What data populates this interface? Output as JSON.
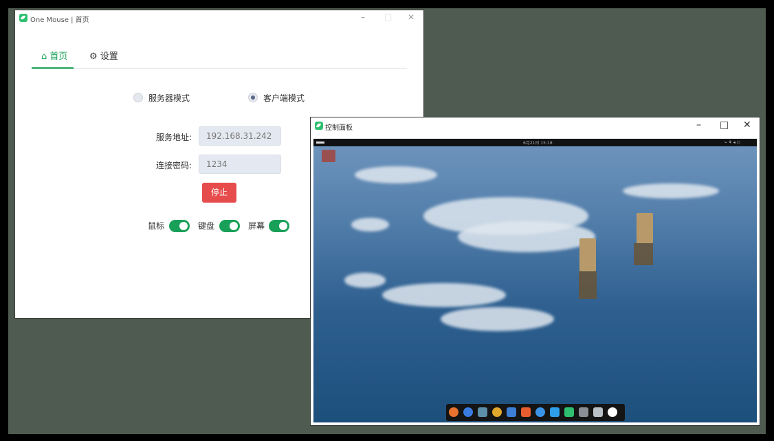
{
  "window1": {
    "title": "One Mouse | 首页",
    "controls": {
      "minimize": "–",
      "maximize": "□",
      "close": "✕"
    },
    "tabs": [
      {
        "icon": "home-icon",
        "glyph": "⌂",
        "label": "首页",
        "active": true
      },
      {
        "icon": "gear-icon",
        "glyph": "⚙",
        "label": "设置",
        "active": false
      }
    ],
    "mode": {
      "options": [
        {
          "label": "服务器模式",
          "checked": false
        },
        {
          "label": "客户端模式",
          "checked": true
        }
      ]
    },
    "server_address": {
      "label": "服务地址:",
      "value": "192.168.31.242"
    },
    "password": {
      "label": "连接密码:",
      "value": "1234"
    },
    "stop_button": "停止",
    "toggles": [
      {
        "label": "鼠标",
        "on": true
      },
      {
        "label": "键盘",
        "on": true
      },
      {
        "label": "屏幕",
        "on": true
      }
    ],
    "accent_color": "#18a058"
  },
  "window2": {
    "title": "控制面板",
    "controls": {
      "minimize": "–",
      "maximize": "□",
      "close": "✕"
    },
    "remote_desktop": {
      "clock": "6月21日 15:18",
      "dock_icons": [
        "firefox-icon",
        "browser-icon",
        "files-icon",
        "music-icon",
        "document-icon",
        "store-icon",
        "help-icon",
        "messenger-icon",
        "onemouse-icon",
        "settings-icon",
        "trash-icon",
        "power-icon"
      ]
    }
  }
}
